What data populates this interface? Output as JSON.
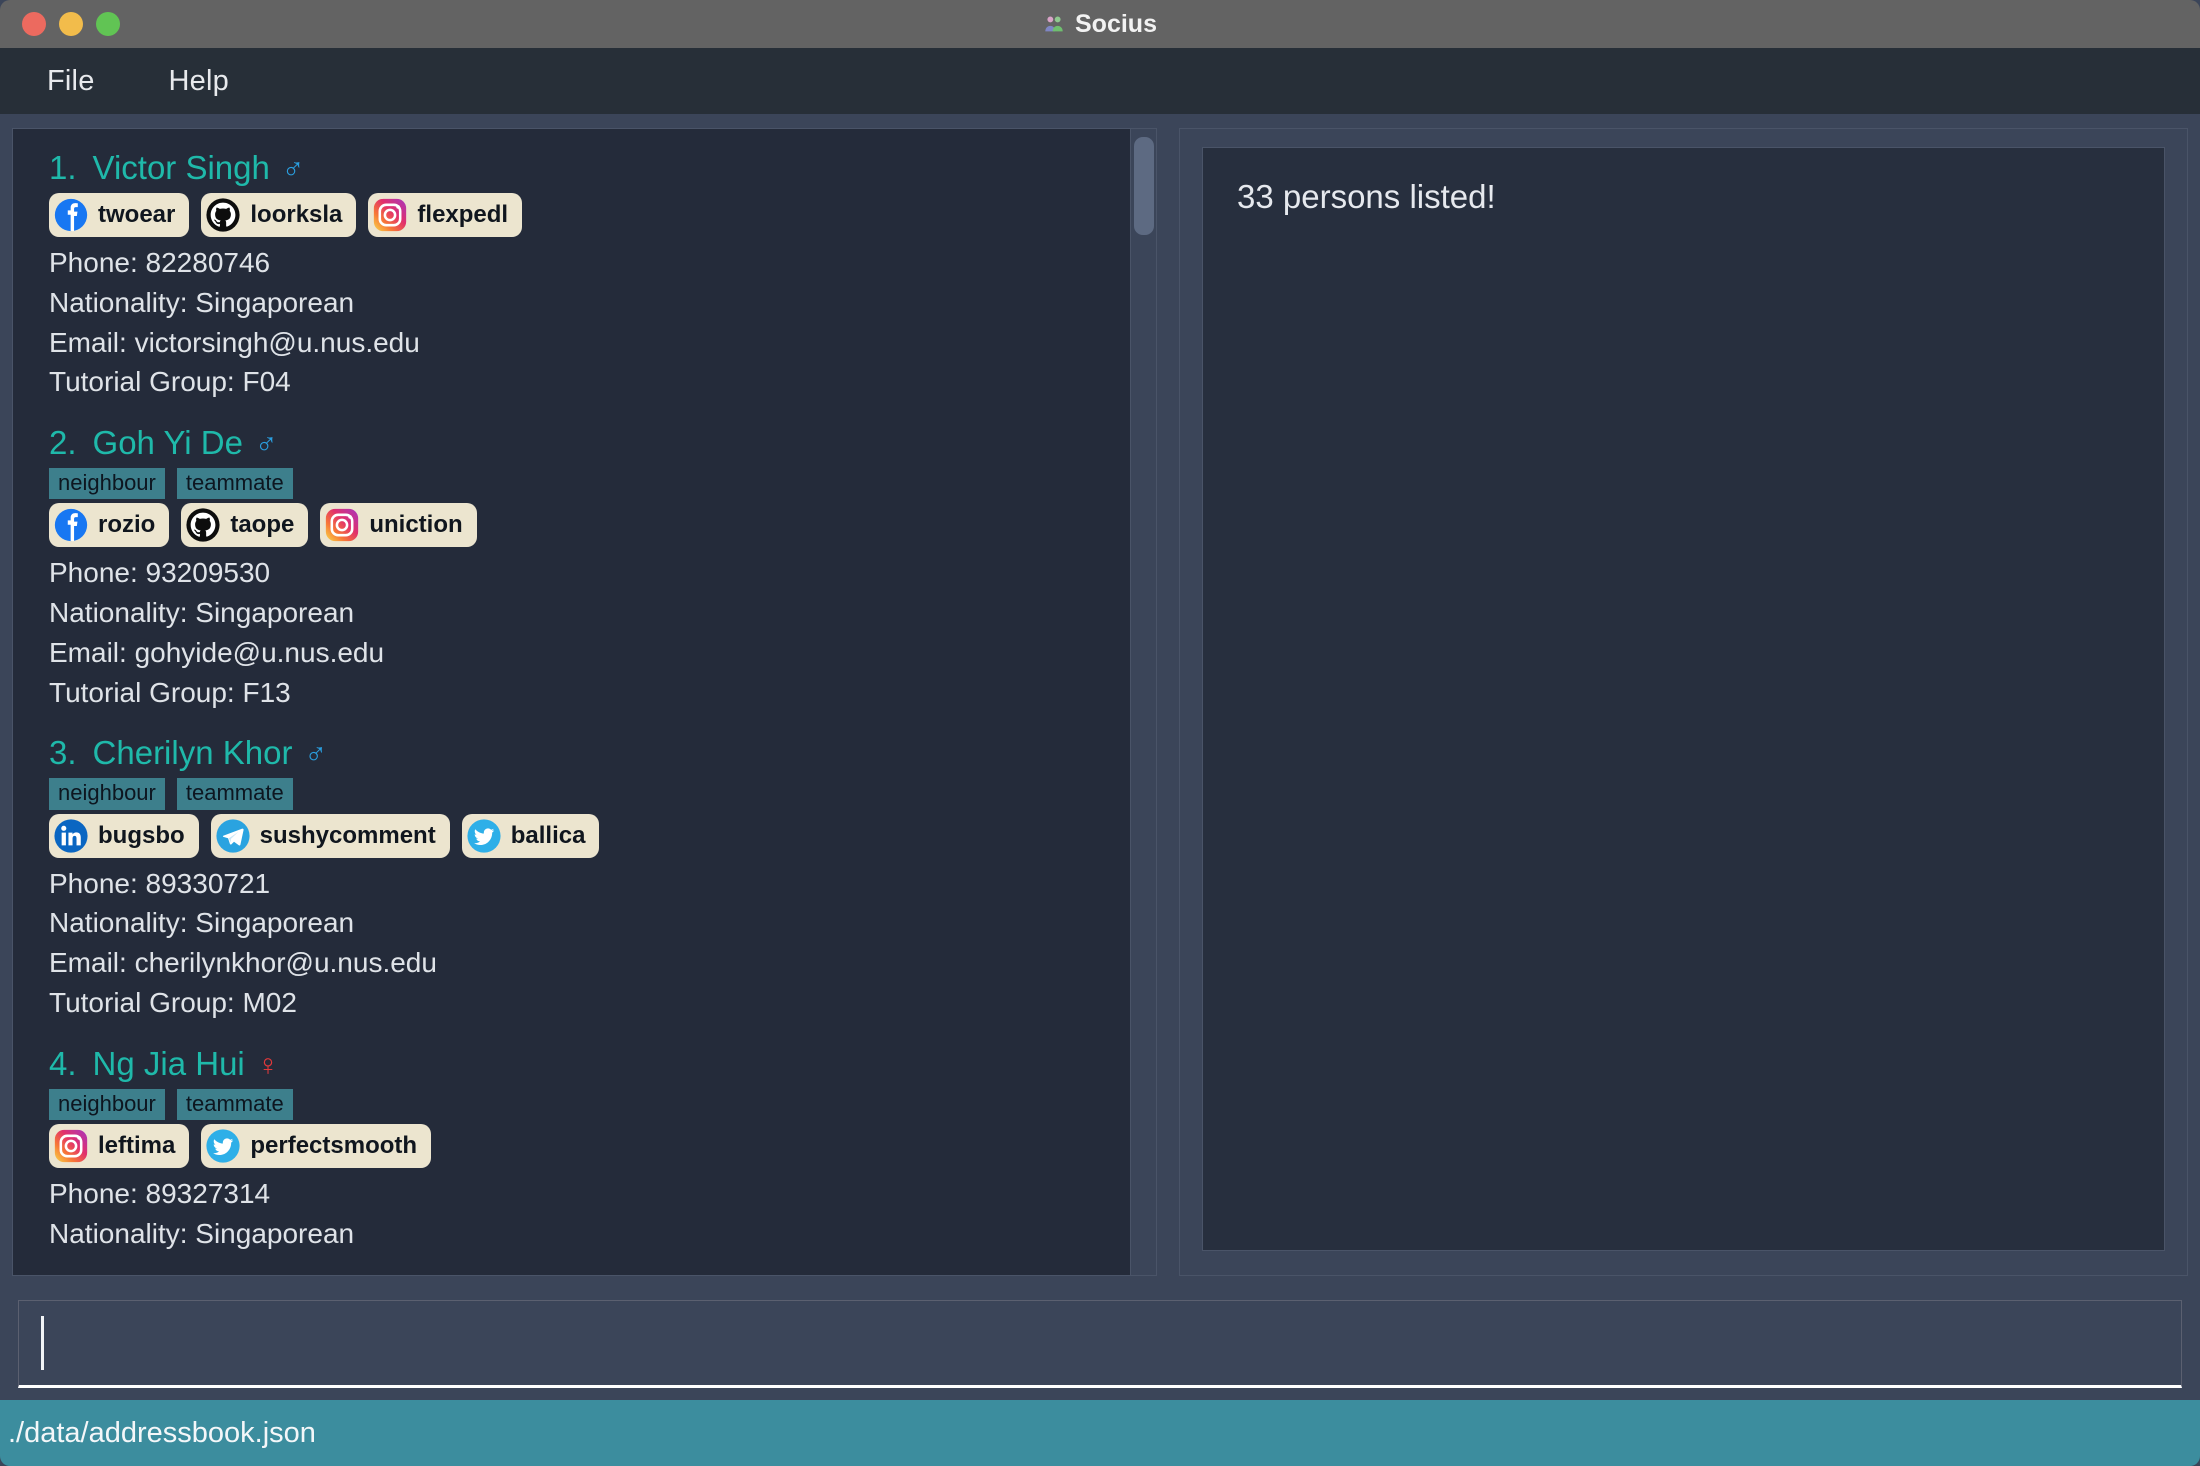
{
  "window": {
    "title": "Socius",
    "app_icon": "people-icon",
    "controls": [
      {
        "name": "close",
        "color": "#ec6a5f"
      },
      {
        "name": "minimize",
        "color": "#f2bc4b"
      },
      {
        "name": "maximize",
        "color": "#61c454"
      }
    ]
  },
  "menubar": {
    "items": [
      {
        "label": "File",
        "name": "menu-file"
      },
      {
        "label": "Help",
        "name": "menu-help"
      }
    ]
  },
  "colors": {
    "accent_name": "#1fb9aa",
    "tag_bg": "#3d7f8c",
    "badge_bg": "#ece5cf",
    "status_bg": "#3c8d9e",
    "male": "#2a9fe0",
    "female": "#e0383a",
    "panel_bg": "#242b3a",
    "body_bg": "#3b4559"
  },
  "person_list": [
    {
      "index": "1.",
      "name": "Victor Singh",
      "gender": "male",
      "gender_symbol": "♂",
      "tags": [],
      "socials": [
        {
          "platform": "facebook",
          "handle": "twoear"
        },
        {
          "platform": "github",
          "handle": "loorksla"
        },
        {
          "platform": "instagram",
          "handle": "flexpedl"
        }
      ],
      "phone": "Phone: 82280746",
      "nationality": "Nationality: Singaporean",
      "email": "Email: victorsingh@u.nus.edu",
      "tutorial": "Tutorial Group: F04"
    },
    {
      "index": "2.",
      "name": "Goh Yi De",
      "gender": "male",
      "gender_symbol": "♂",
      "tags": [
        "neighbour",
        "teammate"
      ],
      "socials": [
        {
          "platform": "facebook",
          "handle": "rozio"
        },
        {
          "platform": "github",
          "handle": "taope"
        },
        {
          "platform": "instagram",
          "handle": "uniction"
        }
      ],
      "phone": "Phone: 93209530",
      "nationality": "Nationality: Singaporean",
      "email": "Email: gohyide@u.nus.edu",
      "tutorial": "Tutorial Group: F13"
    },
    {
      "index": "3.",
      "name": "Cherilyn Khor",
      "gender": "male",
      "gender_symbol": "♂",
      "tags": [
        "neighbour",
        "teammate"
      ],
      "socials": [
        {
          "platform": "linkedin",
          "handle": "bugsbo"
        },
        {
          "platform": "telegram",
          "handle": "sushycomment"
        },
        {
          "platform": "twitter",
          "handle": "ballica"
        }
      ],
      "phone": "Phone: 89330721",
      "nationality": "Nationality: Singaporean",
      "email": "Email: cherilynkhor@u.nus.edu",
      "tutorial": "Tutorial Group: M02"
    },
    {
      "index": "4.",
      "name": "Ng Jia Hui",
      "gender": "female",
      "gender_symbol": "♀",
      "tags": [
        "neighbour",
        "teammate"
      ],
      "socials": [
        {
          "platform": "instagram",
          "handle": "leftima"
        },
        {
          "platform": "twitter",
          "handle": "perfectsmooth"
        }
      ],
      "phone": "Phone: 89327314",
      "nationality": "Nationality: Singaporean",
      "email": "",
      "tutorial": ""
    }
  ],
  "result_panel": {
    "message": "33 persons listed!"
  },
  "command_box": {
    "value": "",
    "placeholder": ""
  },
  "status_bar": {
    "file_path": "./data/addressbook.json"
  }
}
